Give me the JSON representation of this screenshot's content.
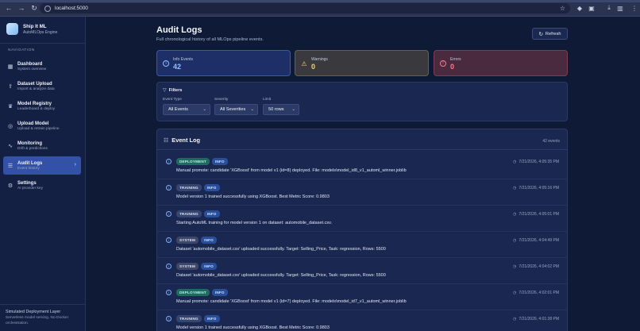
{
  "browser": {
    "url": "localhost:5000"
  },
  "sidebar": {
    "brand_title": "Ship It ML",
    "brand_subtitle": "AutoMLOps Engine",
    "nav_heading": "Navigation",
    "items": [
      {
        "label": "Dashboard",
        "sub": "System overview",
        "icon": "grid-icon"
      },
      {
        "label": "Dataset Upload",
        "sub": "Import & analyze data",
        "icon": "upload-icon"
      },
      {
        "label": "Model Registry",
        "sub": "Leaderboard & deploy",
        "icon": "trophy-icon"
      },
      {
        "label": "Upload Model",
        "sub": "Upload & retrain pipeline",
        "icon": "globe-icon"
      },
      {
        "label": "Monitoring",
        "sub": "Drift & predictions",
        "icon": "activity-icon"
      },
      {
        "label": "Audit Logs",
        "sub": "Event history",
        "icon": "list-icon",
        "active": true
      },
      {
        "label": "Settings",
        "sub": "AI provider key",
        "icon": "gear-icon"
      }
    ],
    "footer_title": "Simulated Deployment Layer",
    "footer_desc": "Serverless model serving. No Docker orchestration."
  },
  "main": {
    "title": "Audit Logs",
    "subtitle": "Full chronological history of all MLOps pipeline events.",
    "refresh_label": "Refresh"
  },
  "stats": {
    "info": {
      "label": "Info Events",
      "value": "42"
    },
    "warnings": {
      "label": "Warnings",
      "value": "0"
    },
    "errors": {
      "label": "Errors",
      "value": "0"
    }
  },
  "filters": {
    "heading": "Filters",
    "event_type_label": "Event Type",
    "event_type_value": "All Events",
    "severity_label": "Severity",
    "severity_value": "All Severities",
    "limit_label": "Limit",
    "limit_value": "50 rows"
  },
  "event_log": {
    "title": "Event Log",
    "count": "42 events",
    "rows": [
      {
        "type": "DEPLOYMENT",
        "severity": "INFO",
        "message": "Manual promote: candidate 'XGBoost' from model v1 (id=8) deployed. File: models\\model_id8_v1_automl_winner.joblib",
        "timestamp": "7/21/2026, 4:05:35 PM"
      },
      {
        "type": "TRAINING",
        "severity": "INFO",
        "message": "Model version 1 trained successfully using XGBoost. Best Metric Score: 0.9803",
        "timestamp": "7/21/2026, 4:05:16 PM"
      },
      {
        "type": "TRAINING",
        "severity": "INFO",
        "message": "Starting AutoML training for model version 1 on dataset: automobile_dataset.csv.",
        "timestamp": "7/21/2026, 4:05:01 PM"
      },
      {
        "type": "SYSTEM",
        "severity": "INFO",
        "message": "Dataset 'automobile_dataset.csv' uploaded successfully. Target: Selling_Price, Task: regression, Rows: 5500",
        "timestamp": "7/21/2026, 4:04:49 PM"
      },
      {
        "type": "SYSTEM",
        "severity": "INFO",
        "message": "Dataset 'automobile_dataset.csv' uploaded successfully. Target: Selling_Price, Task: regression, Rows: 5500",
        "timestamp": "7/21/2026, 4:04:02 PM"
      },
      {
        "type": "DEPLOYMENT",
        "severity": "INFO",
        "message": "Manual promote: candidate 'XGBoost' from model v1 (id=7) deployed. File: models\\model_id7_v1_automl_winner.joblib",
        "timestamp": "7/21/2026, 4:02:01 PM"
      },
      {
        "type": "TRAINING",
        "severity": "INFO",
        "message": "Model version 1 trained successfully using XGBoost. Best Metric Score: 0.9803",
        "timestamp": "7/21/2026, 4:01:38 PM"
      }
    ]
  }
}
